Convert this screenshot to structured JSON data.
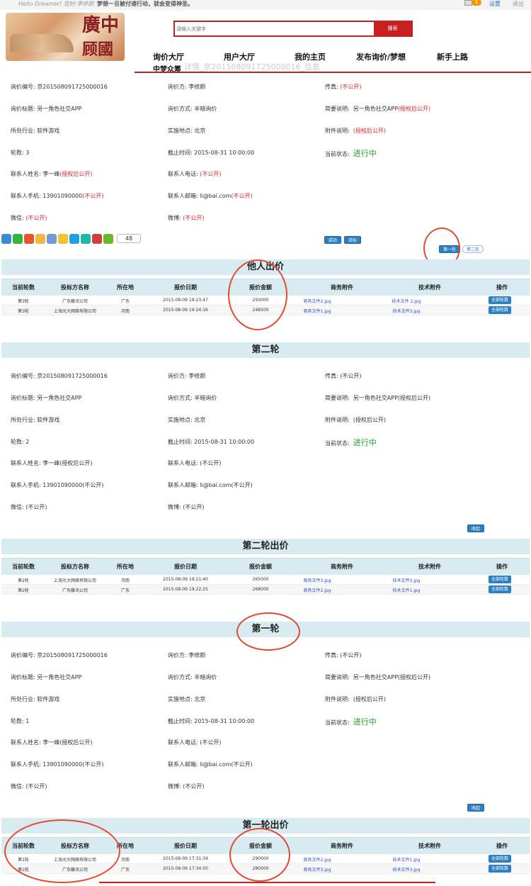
{
  "topbar": {
    "hello": "Hello Dreamer! 您好:李修颜",
    "slogan": "梦想一旦被付诸行动，就会变得神圣。",
    "message_count": "1",
    "settings": "设置",
    "logout": "退出"
  },
  "search": {
    "placeholder": "请输入关键字",
    "button": "搜索"
  },
  "nav": {
    "items": [
      "询价大厅",
      "用户大厅",
      "我的主页",
      "发布询价/梦想",
      "新手上路"
    ],
    "sub": "中梦众筹",
    "ghost_title": "详情_京201508091725000016_信息"
  },
  "labels": {
    "inquiry_no": "询价编号:",
    "inquiry_party": "询价方:",
    "fax": "传真:",
    "inquiry_title": "询价标题:",
    "inquiry_method": "询价方式:",
    "brief": "简要说明:",
    "industry": "所处行业:",
    "location": "实施地点:",
    "attachment": "附件说明:",
    "rounds": "轮数:",
    "deadline": "截止时间:",
    "status": "当前状态:",
    "contact_name": "联系人姓名:",
    "contact_phone": "联系人电话:",
    "contact_mobile": "联系人手机:",
    "contact_email": "联系人邮箱:",
    "wechat": "微信:",
    "weibo": "微博:"
  },
  "round3": {
    "inquiry_no": "京201508091725000016",
    "inquiry_party": "李修颜",
    "fax": "(不公开)",
    "inquiry_title": "另一角色社交APP",
    "inquiry_method": "半暗询价",
    "brief_text": "另一角色社交APP",
    "brief_note": "(授权后公开)",
    "industry": "软件游戏",
    "location": "北京",
    "attachment": "(授权后公开)",
    "rounds": "3",
    "deadline": "2015-08-31 10:00:00",
    "status": "进行中",
    "contact_name": "李一峰",
    "contact_name_note": "(授权后公开)",
    "contact_phone": "(不公开)",
    "contact_mobile": "13901090000",
    "contact_mobile_note": "(不公开)",
    "contact_email": "li@bai.com",
    "contact_email_note": "(不公开)",
    "wechat": "(不公开)",
    "weibo": "(不公开)"
  },
  "share": {
    "count": "48"
  },
  "actions": {
    "success": "成功",
    "fail": "流标",
    "round1": "第一轮",
    "round2": "第二轮",
    "collapse": "收起"
  },
  "table_headers": [
    "当前轮数",
    "投标方名称",
    "所在地",
    "报价日期",
    "报价金额",
    "商务附件",
    "技术附件",
    "操作"
  ],
  "bids_title": "他人出价",
  "bids_round3": [
    {
      "round": "第3轮",
      "name": "广东藤讯公司",
      "place": "广东",
      "date": "2015-08-09 19:23:47",
      "amount": "250000",
      "biz": "商务文件2.jpg",
      "tech": "技术文件 2.jpg",
      "op": "全部轮数"
    },
    {
      "round": "第3轮",
      "name": "上海光大网络有限公司",
      "place": "河南",
      "date": "2015-08-09 19:24:16",
      "amount": "248500",
      "biz": "商务文件1.jpg",
      "tech": "技术文件3.jpg",
      "op": "全部轮数"
    }
  ],
  "round2_title": "第二轮",
  "round2": {
    "inquiry_no": "京201508091725000016",
    "inquiry_party": "李修颜",
    "fax": "(不公开)",
    "inquiry_title": "另一角色社交APP",
    "inquiry_method": "半暗询价",
    "brief": "另一角色社交APP(授权后公开)",
    "industry": "软件游戏",
    "location": "北京",
    "attachment": "(授权后公开)",
    "rounds": "2",
    "deadline": "2015-08-31 10:00:00",
    "status": "进行中",
    "contact_name": "李一峰(授权后公开)",
    "contact_phone": "(不公开)",
    "contact_mobile": "13901090000(不公开)",
    "contact_email": "li@bai.com(不公开)",
    "wechat": "(不公开)",
    "weibo": "(不公开)"
  },
  "round2_bids_title": "第二轮出价",
  "bids_round2": [
    {
      "round": "第2轮",
      "name": "上海光大网络有限公司",
      "place": "河南",
      "date": "2015-08-09 19:21:40",
      "amount": "265000",
      "biz": "商务文件3.jpg",
      "tech": "技术文件3.jpg",
      "op": "全部轮数"
    },
    {
      "round": "第2轮",
      "name": "广东藤讯公司",
      "place": "广东",
      "date": "2015-08-09 19:22:25",
      "amount": "268000",
      "biz": "商务文件2.jpg",
      "tech": "技术文件1.jpg",
      "op": "全部轮数"
    }
  ],
  "round1_title": "第一轮",
  "round1": {
    "inquiry_no": "京201508091725000016",
    "inquiry_party": "李修颜",
    "fax": "(不公开)",
    "inquiry_title": "另一角色社交APP",
    "inquiry_method": "半暗询价",
    "brief": "另一角色社交APP(授权后公开)",
    "industry": "软件游戏",
    "location": "北京",
    "attachment": "(授权后公开)",
    "rounds": "1",
    "deadline": "2015-08-31 10:00:00",
    "status": "进行中",
    "contact_name": "李一峰(授权后公开)",
    "contact_phone": "(不公开)",
    "contact_mobile": "13901090000(不公开)",
    "contact_email": "li@bai.com(不公开)",
    "wechat": "(不公开)",
    "weibo": "(不公开)"
  },
  "round1_bids_title": "第一轮出价",
  "bids_round1": [
    {
      "round": "第1轮",
      "name": "上海光大网络有限公司",
      "place": "河南",
      "date": "2015-08-09 17:31:34",
      "amount": "290000",
      "biz": "商务文件2.jpg",
      "tech": "技术文件1.jpg",
      "op": "全部轮数"
    },
    {
      "round": "第1轮",
      "name": "广东藤讯公司",
      "place": "广东",
      "date": "2015-08-09 17:34:50",
      "amount": "280000",
      "biz": "商务文件3.jpg",
      "tech": "技术文件3.jpg",
      "op": "全部轮数"
    }
  ],
  "colors": {
    "accent_red": "#c81f1f",
    "section_bg": "#d7ebf0",
    "button_blue": "#2d7fc1",
    "status_green": "#1a9a28",
    "annotation_red": "#e24a33"
  }
}
